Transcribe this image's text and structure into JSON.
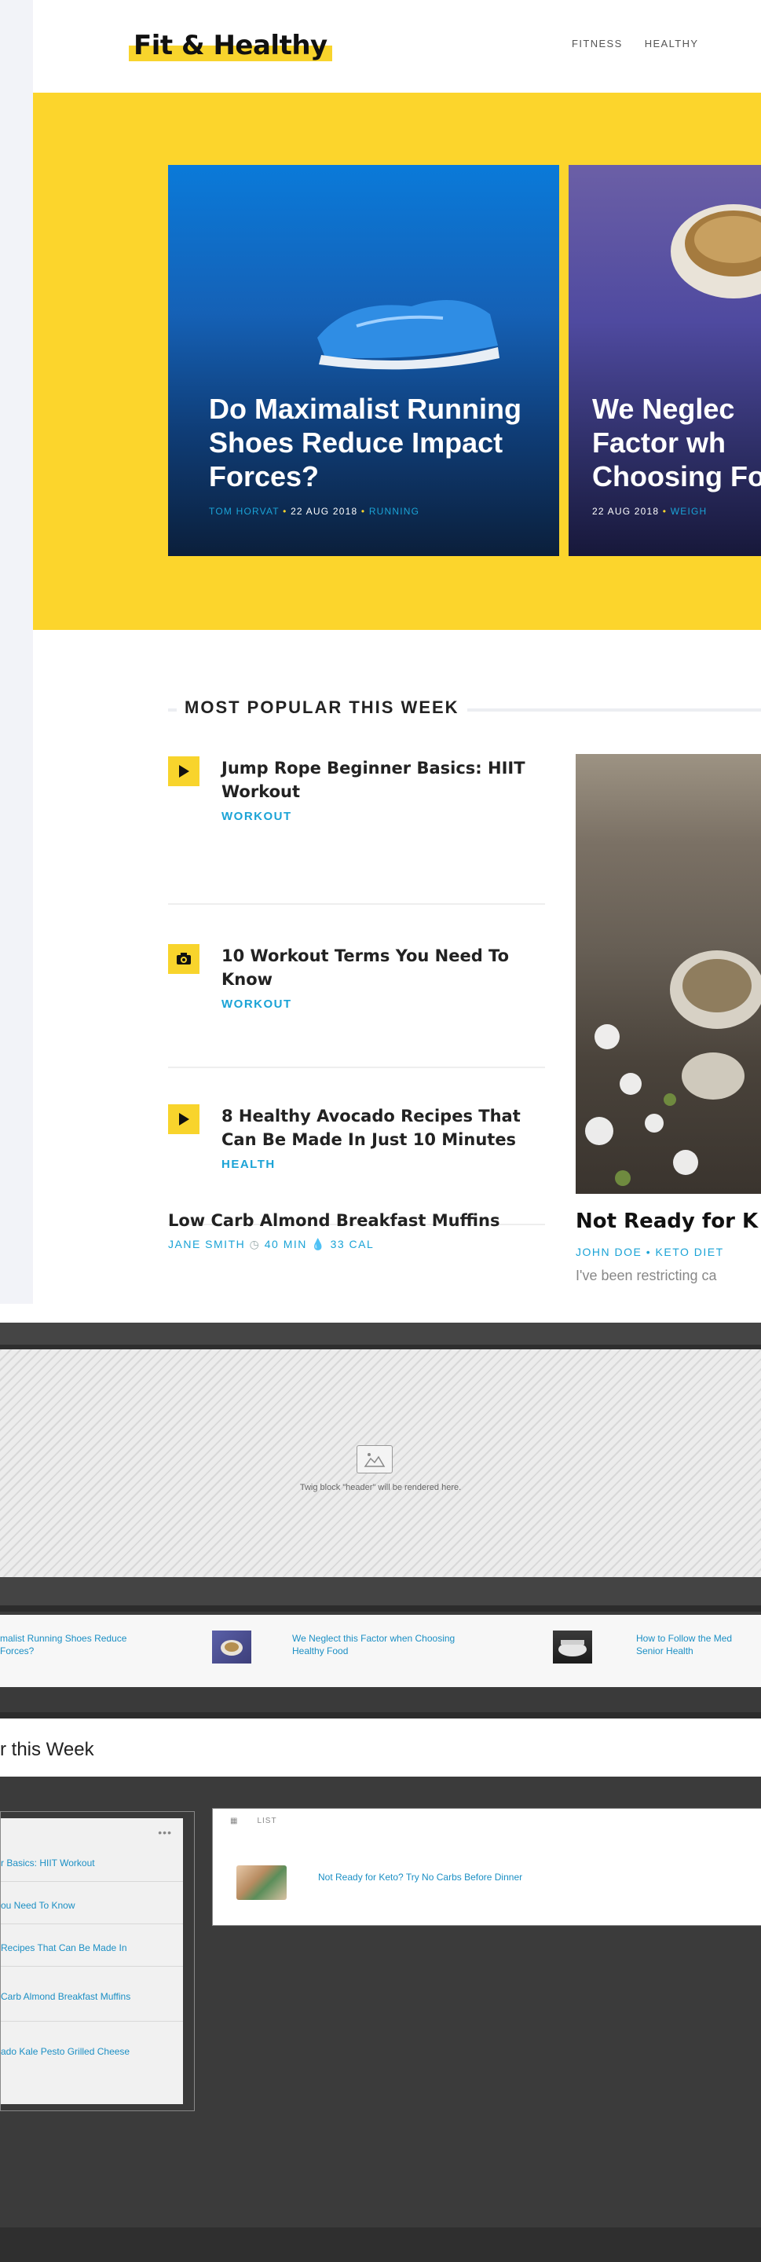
{
  "site": {
    "logo": "Fit & Healthy",
    "nav": [
      "FITNESS",
      "HEALTHY"
    ],
    "hero": [
      {
        "title": "Do Maximalist Running Shoes Reduce Impact Forces?",
        "author": "TOM HORVAT",
        "date": "22 AUG 2018",
        "category": "RUNNING"
      },
      {
        "title": "We Neglect this Factor when Choosing Healthy Food",
        "title_visible": "We Neglec Factor wh Choosing Food",
        "date": "22 AUG 2018",
        "category": "WEIGH"
      }
    ],
    "popular_heading": "MOST POPULAR THIS WEEK",
    "popular": [
      {
        "title": "Jump Rope Beginner Basics: HIIT Workout",
        "tag": "WORKOUT",
        "icon": "play-icon"
      },
      {
        "title": "10 Workout Terms You Need To Know",
        "tag": "WORKOUT",
        "icon": "camera-icon"
      },
      {
        "title": "8 Healthy Avocado Recipes That Can Be Made In Just 10 Minutes",
        "tag": "HEALTH",
        "icon": "play-icon"
      }
    ],
    "lowcarb": {
      "title": "Low Carb Almond Breakfast Muffins",
      "author": "JANE SMITH",
      "time": "40 MIN",
      "cal": "33 CAL"
    },
    "featured": {
      "title": "Not Ready for K",
      "author": "JOHN DOE",
      "category": "KETO DIET",
      "excerpt": "I've been restricting ca"
    }
  },
  "editor": {
    "placeholder_text": "Twig block \"header\" will be rendered here.",
    "strip_items": [
      "malist Running Shoes Reduce\nForces?",
      "We Neglect this Factor when Choosing\nHealthy Food",
      "How to Follow the Med\nSenior Health"
    ],
    "section_title": "r this Week",
    "left_panel_dots": "•••",
    "left_list": [
      "r Basics: HIIT Workout",
      "ou Need To Know",
      "Recipes That Can Be Made In",
      "Carb Almond Breakfast Muffins",
      "ado Kale Pesto Grilled Cheese"
    ],
    "right_tabs": "LIST",
    "right_link": "Not Ready for Keto? Try No Carbs Before Dinner"
  },
  "colors": {
    "yellow": "#fcd52c",
    "accent": "#1aa3d6",
    "link": "#1b8fc4"
  }
}
